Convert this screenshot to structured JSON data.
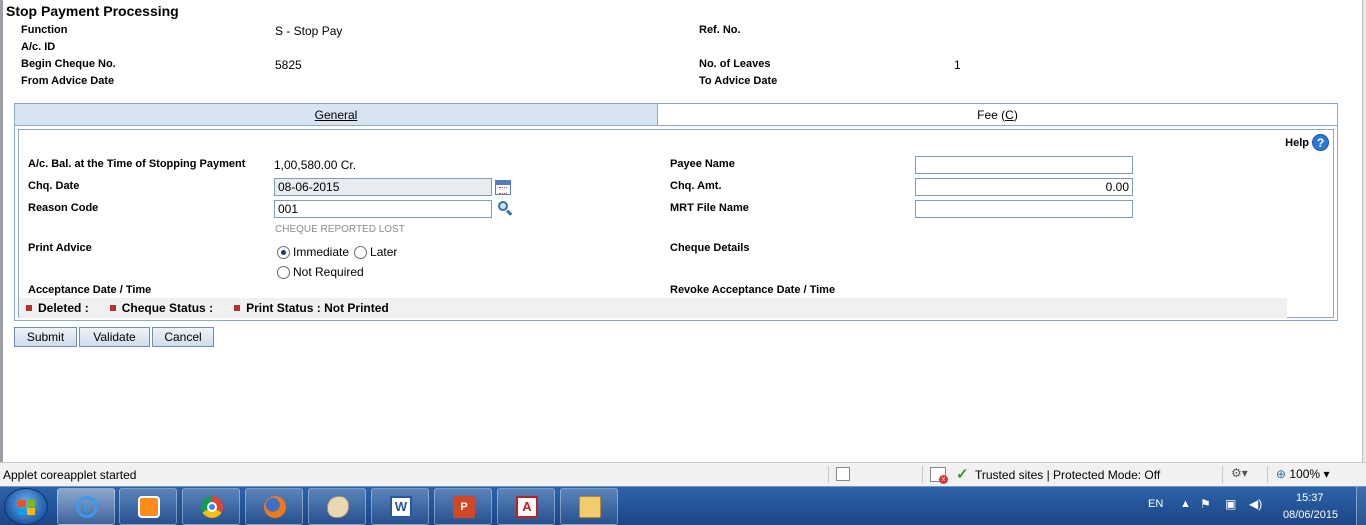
{
  "header": {
    "title": "Stop Payment Processing",
    "function_label": "Function",
    "function_value": "S - Stop Pay",
    "ref_no_label": "Ref. No.",
    "ac_id_label": "A/c. ID",
    "begin_cheque_label": "Begin Cheque No.",
    "begin_cheque_value": "5825",
    "no_of_leaves_label": "No. of Leaves",
    "no_of_leaves_value": "1",
    "from_advice_label": "From Advice Date",
    "to_advice_label": "To Advice Date"
  },
  "tabs": {
    "general": "General",
    "fee_prefix": "Fee (",
    "fee_key": "C",
    "fee_suffix": ")"
  },
  "help_label": "Help",
  "form": {
    "ac_bal_label": "A/c. Bal. at the Time of Stopping Payment",
    "ac_bal_value": "1,00,580.00 Cr.",
    "chq_date_label": "Chq. Date",
    "chq_date_value": "08-06-2015",
    "reason_code_label": "Reason Code",
    "reason_code_value": "001",
    "reason_code_hint": "CHEQUE REPORTED LOST",
    "print_advice_label": "Print Advice",
    "radio_immediate": "Immediate",
    "radio_later": "Later",
    "radio_not_required": "Not Required",
    "acceptance_label": "Acceptance Date / Time",
    "payee_name_label": "Payee Name",
    "payee_name_value": "",
    "chq_amt_label": "Chq. Amt.",
    "chq_amt_value": "0.00",
    "mrt_file_label": "MRT File Name",
    "mrt_file_value": "",
    "cheque_details_label": "Cheque Details",
    "revoke_label": "Revoke Acceptance Date / Time"
  },
  "status_strip": {
    "deleted": "Deleted",
    "cheque_status": "Cheque Status",
    "print_status": "Print Status",
    "print_status_value": "Not Printed",
    "sep": ":"
  },
  "buttons": {
    "submit": "Submit",
    "validate": "Validate",
    "cancel": "Cancel"
  },
  "ie_status": {
    "text": "Applet coreapplet started",
    "zone": "Trusted sites | Protected Mode: Off",
    "zoom": "100%"
  },
  "tray": {
    "lang": "EN",
    "time": "15:37",
    "date": "08/06/2015"
  },
  "taskbar_apps": [
    "internet-explorer-icon",
    "media-player-icon",
    "chrome-icon",
    "firefox-icon",
    "paint-icon",
    "word-icon",
    "powerpoint-icon",
    "acrobat-icon",
    "file-explorer-icon"
  ],
  "colors": {
    "tab_active": "#d9e4f2",
    "panel_border": "#8fa7c8",
    "status_square": "#b3322b",
    "taskbar": "#1c4688"
  }
}
